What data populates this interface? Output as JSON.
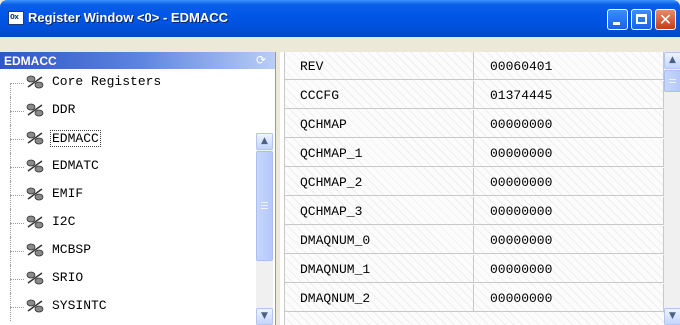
{
  "window": {
    "title": "Register Window <0> - EDMACC",
    "icon": "register-window-icon",
    "icon_text": "0x",
    "controls": [
      "minimize",
      "maximize",
      "close"
    ]
  },
  "left_pane": {
    "header": "EDMACC",
    "tree": [
      {
        "label": "Core Registers",
        "icon": "register-group-icon"
      },
      {
        "label": "DDR",
        "icon": "register-group-icon"
      },
      {
        "label": "EDMACC",
        "icon": "register-group-icon",
        "selected": true
      },
      {
        "label": "EDMATC",
        "icon": "register-group-icon"
      },
      {
        "label": "EMIF",
        "icon": "register-group-icon"
      },
      {
        "label": "I2C",
        "icon": "register-group-icon"
      },
      {
        "label": "MCBSP",
        "icon": "register-group-icon"
      },
      {
        "label": "SRIO",
        "icon": "register-group-icon"
      },
      {
        "label": "SYSINTC",
        "icon": "register-group-icon"
      }
    ]
  },
  "registers": [
    {
      "name": "REV",
      "value": "00060401"
    },
    {
      "name": "CCCFG",
      "value": "01374445"
    },
    {
      "name": "QCHMAP",
      "value": "00000000"
    },
    {
      "name": "QCHMAP_1",
      "value": "00000000"
    },
    {
      "name": "QCHMAP_2",
      "value": "00000000"
    },
    {
      "name": "QCHMAP_3",
      "value": "00000000"
    },
    {
      "name": "DMAQNUM_0",
      "value": "00000000"
    },
    {
      "name": "DMAQNUM_1",
      "value": "00000000"
    },
    {
      "name": "DMAQNUM_2",
      "value": "00000000"
    }
  ],
  "colors": {
    "titlebar": "#0054e3",
    "header_gradient_start": "#2d57c5",
    "close_button": "#c33d1a"
  }
}
